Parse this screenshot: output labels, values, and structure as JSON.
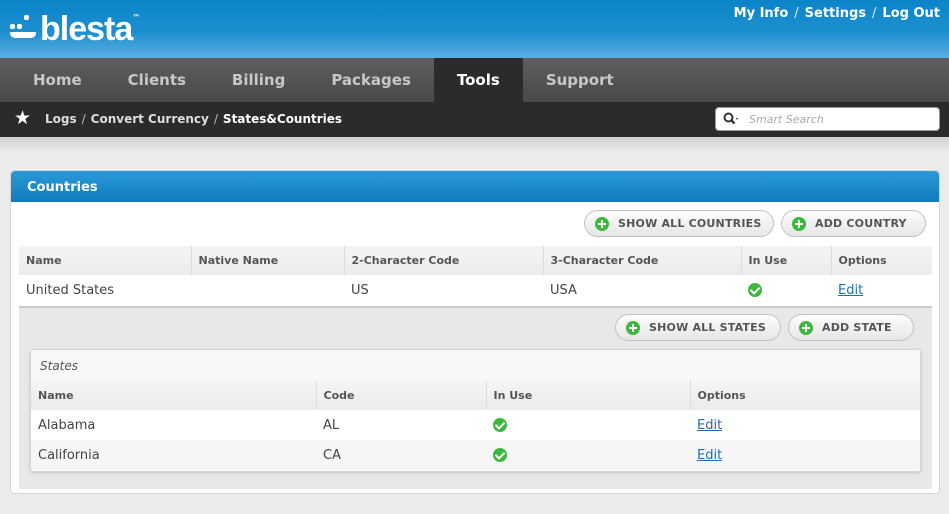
{
  "header": {
    "logo_text": "blesta",
    "logo_tm": "™",
    "links": [
      "My Info",
      "Settings",
      "Log Out"
    ],
    "link_separator": "/"
  },
  "nav": {
    "items": [
      {
        "label": "Home",
        "active": false
      },
      {
        "label": "Clients",
        "active": false
      },
      {
        "label": "Billing",
        "active": false
      },
      {
        "label": "Packages",
        "active": false
      },
      {
        "label": "Tools",
        "active": true
      },
      {
        "label": "Support",
        "active": false
      }
    ]
  },
  "breadcrumb": {
    "items": [
      "Logs",
      "Convert Currency",
      "States&Countries"
    ],
    "separator": "/"
  },
  "search": {
    "placeholder": "Smart Search"
  },
  "countries_panel": {
    "title": "Countries",
    "show_all_label": "SHOW ALL COUNTRIES",
    "add_label": "ADD COUNTRY",
    "columns": [
      "Name",
      "Native Name",
      "2-Character Code",
      "3-Character Code",
      "In Use",
      "Options"
    ],
    "rows": [
      {
        "name": "United States",
        "native_name": "",
        "code2": "US",
        "code3": "USA",
        "in_use": true,
        "option": "Edit"
      }
    ]
  },
  "states_panel": {
    "title": "States",
    "show_all_label": "SHOW ALL STATES",
    "add_label": "ADD STATE",
    "columns": [
      "Name",
      "Code",
      "In Use",
      "Options"
    ],
    "rows": [
      {
        "name": "Alabama",
        "code": "AL",
        "in_use": true,
        "option": "Edit"
      },
      {
        "name": "California",
        "code": "CA",
        "in_use": true,
        "option": "Edit"
      }
    ]
  },
  "colors": {
    "brand_blue": "#0f7cbd",
    "nav_dark": "#2b2b2b",
    "success_green": "#3cb83c",
    "link_blue": "#1e6fb7"
  }
}
